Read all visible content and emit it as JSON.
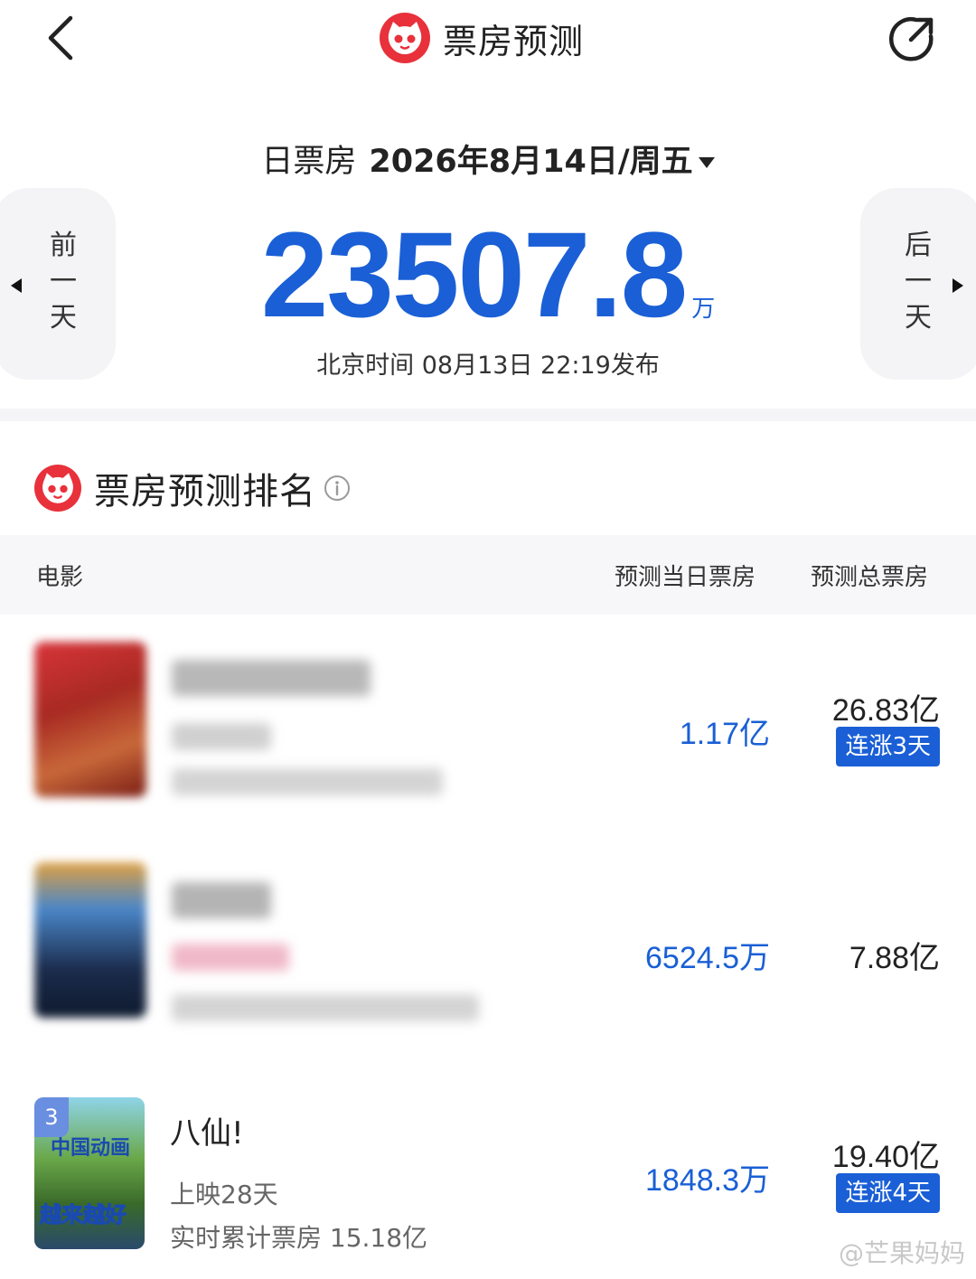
{
  "header": {
    "title": "票房预测",
    "back_icon": "chevron-left-icon",
    "share_icon": "share-icon"
  },
  "date_selector": {
    "label": "日票房",
    "value": "2026年8月14日/周五"
  },
  "nav": {
    "prev": [
      "前",
      "一",
      "天"
    ],
    "next": [
      "后",
      "一",
      "天"
    ]
  },
  "summary": {
    "total": "23507.8",
    "unit": "万",
    "publish": "北京时间  08月13日  22:19发布"
  },
  "ranking": {
    "title": "票房预测排名",
    "columns": {
      "movie": "电影",
      "day": "预测当日票房",
      "total": "预测总票房"
    },
    "rows": [
      {
        "day": "1.17亿",
        "total": "26.83亿",
        "badge": "连涨3天"
      },
      {
        "day": "6524.5万",
        "total": "7.88亿"
      },
      {
        "rank": "3",
        "name": "八仙!",
        "released": "上映28天",
        "cumulative": "实时累计票房 15.18亿",
        "poster_text_1": "中国动画",
        "poster_text_2": "越来越好",
        "day": "1848.3万",
        "total": "19.40亿",
        "badge": "连涨4天"
      }
    ]
  },
  "watermark": "@芒果妈妈",
  "colors": {
    "accent": "#1a5fd6",
    "logo_red": "#e8313b"
  }
}
